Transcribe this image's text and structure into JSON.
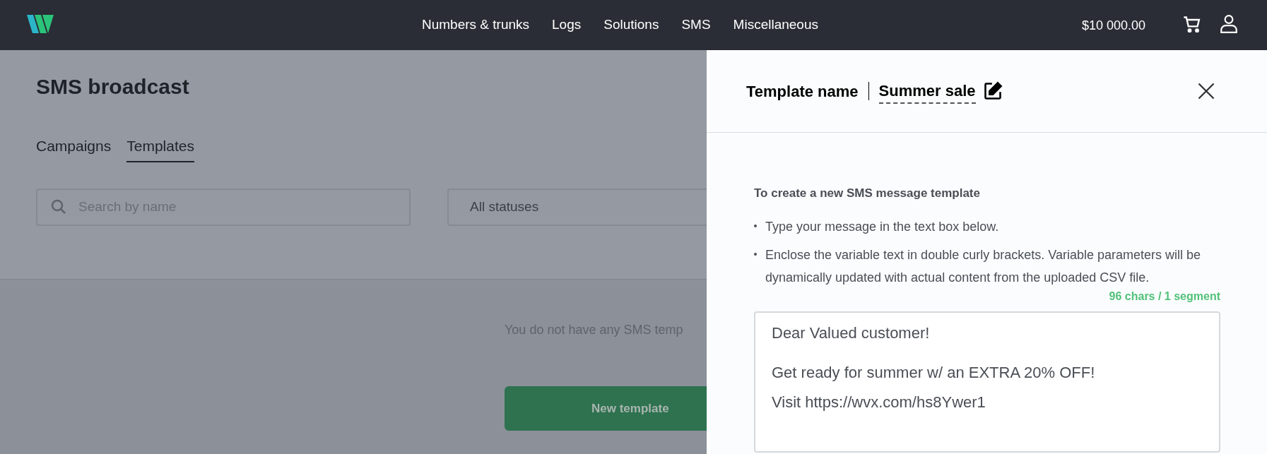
{
  "header": {
    "nav": [
      {
        "label": "Numbers & trunks"
      },
      {
        "label": "Logs"
      },
      {
        "label": "Solutions"
      },
      {
        "label": "SMS"
      },
      {
        "label": "Miscellaneous"
      }
    ],
    "balance": "$10 000.00"
  },
  "page": {
    "title": "SMS broadcast",
    "tabs": [
      {
        "label": "Campaigns",
        "selected": false
      },
      {
        "label": "Templates",
        "selected": true
      }
    ],
    "search": {
      "placeholder": "Search by name"
    },
    "status_filter": {
      "value": "All statuses"
    },
    "empty_message": "You do not have any SMS temp",
    "new_button": "New template"
  },
  "panel": {
    "title_label": "Template name",
    "template_name": "Summer sale",
    "instructions_title": "To create a new SMS message template",
    "instructions": [
      "Type your message in the text box below.",
      "Enclose the variable text in double curly brackets. Variable parameters will be dynamically updated with actual content from the uploaded CSV file."
    ],
    "counter": "96 chars / 1 segment",
    "message_lines": [
      "Dear Valued customer!",
      "Get ready for summer w/ an EXTRA 20% OFF!",
      "Visit https://wvx.com/hs8Ywer1"
    ]
  }
}
